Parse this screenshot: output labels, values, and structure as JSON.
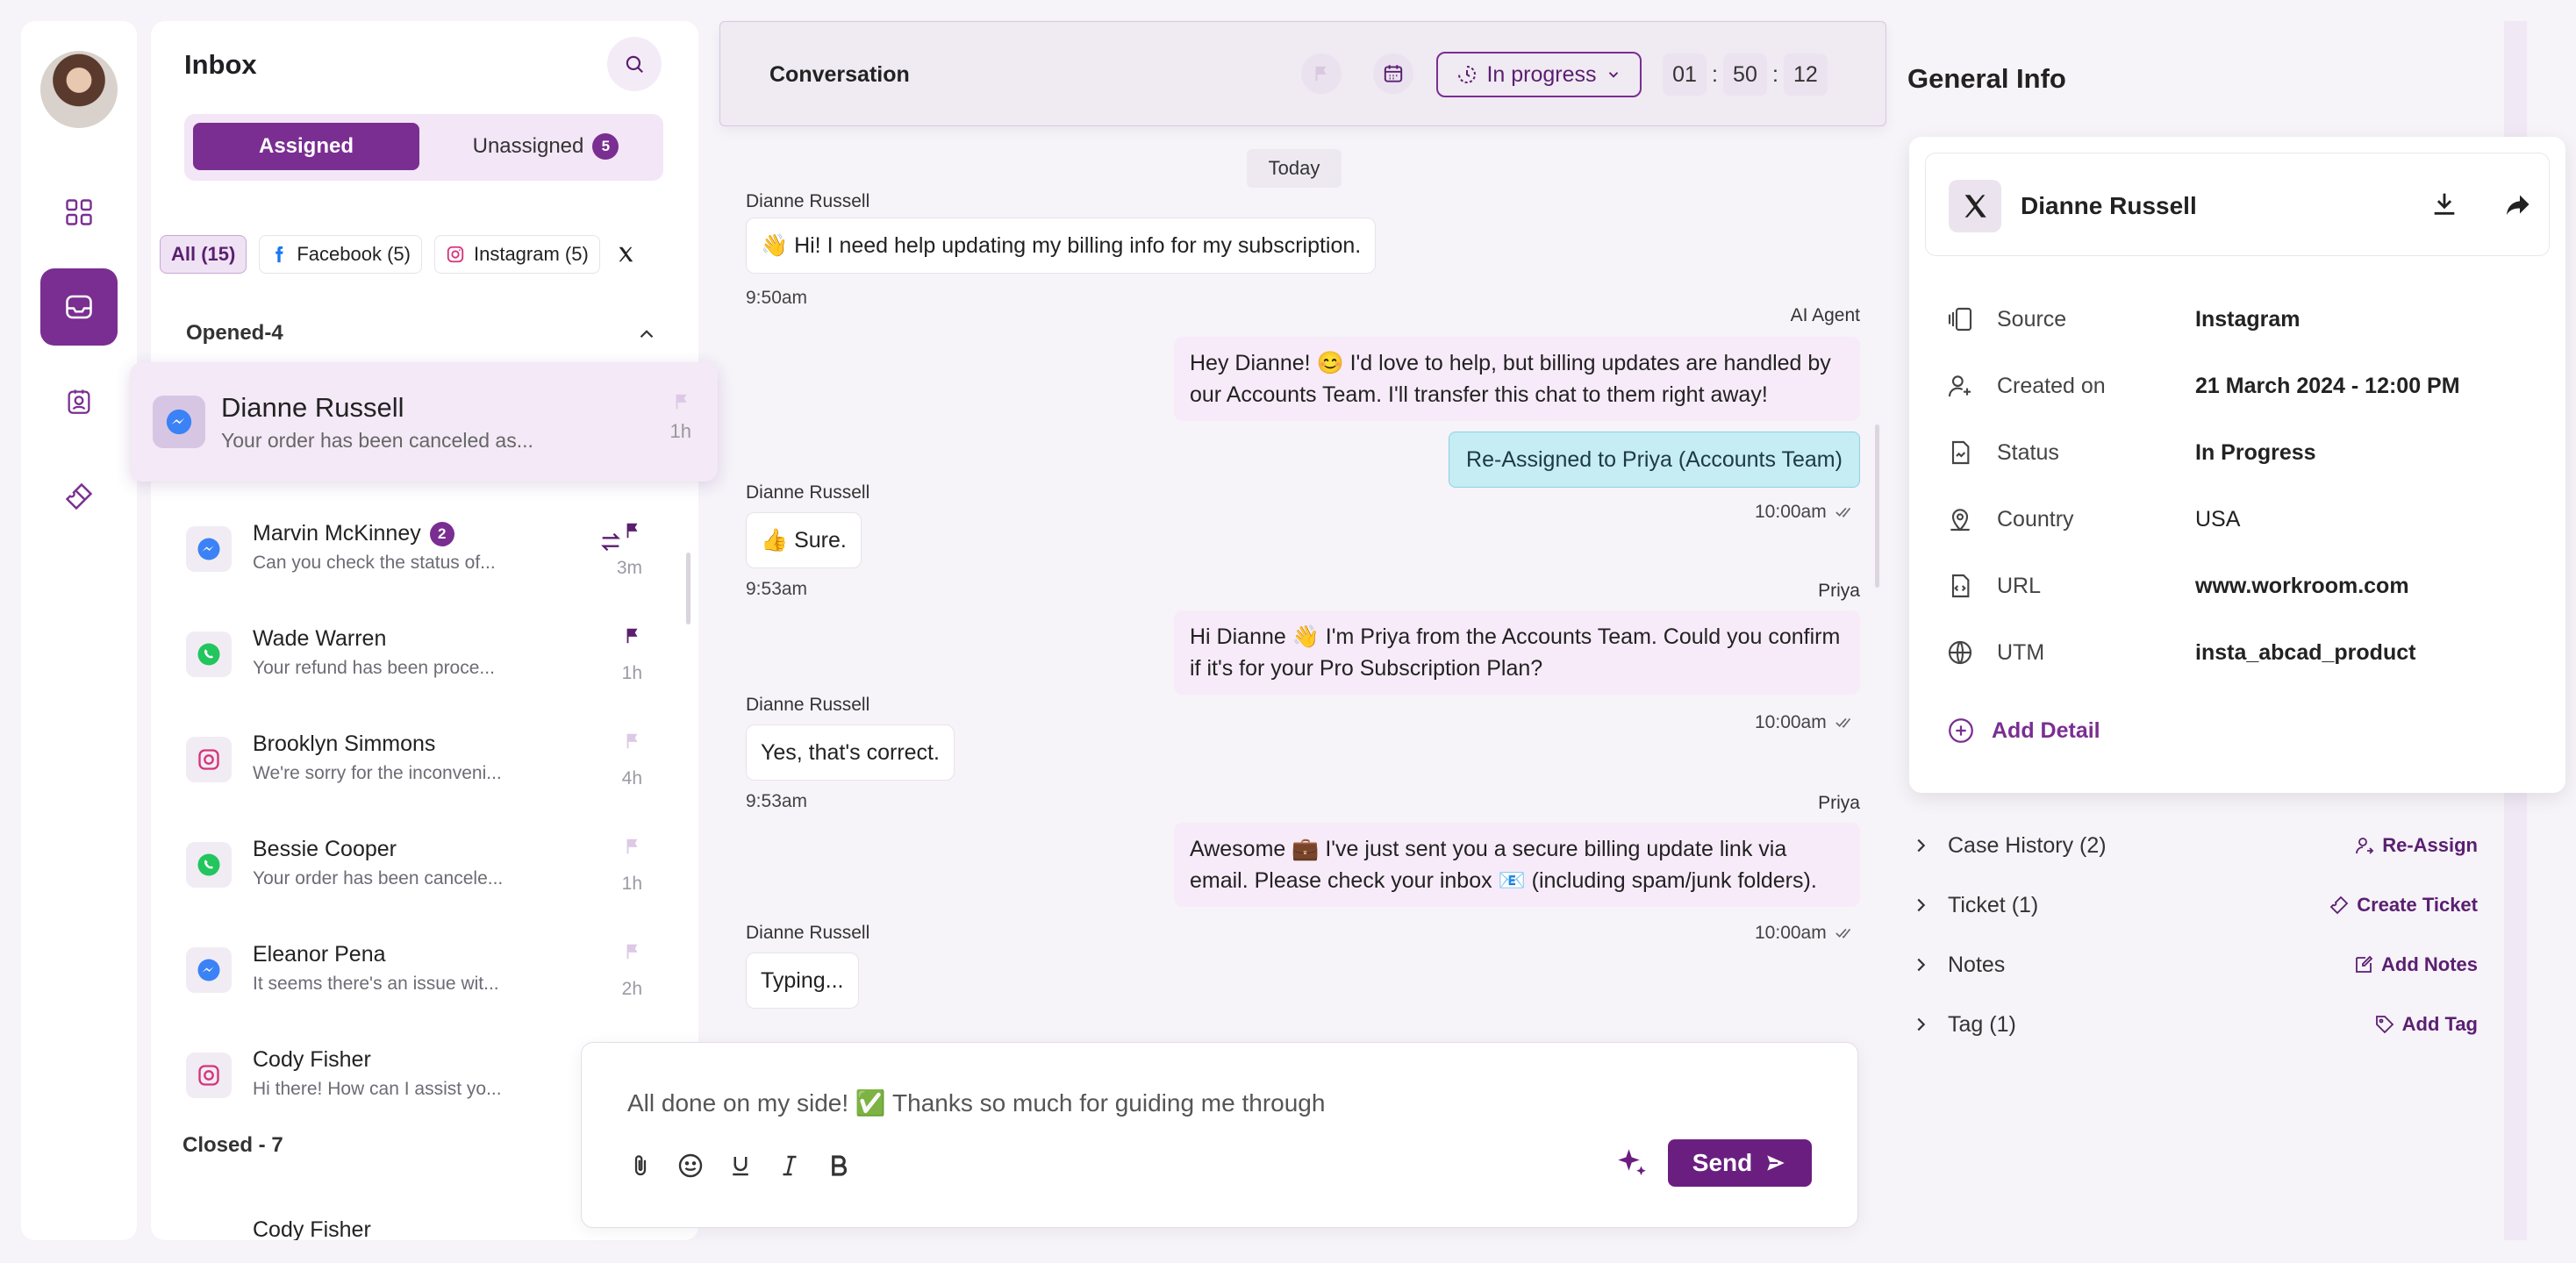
{
  "rail": {
    "items": [
      "dashboard-icon",
      "inbox-icon",
      "contacts-icon",
      "tickets-icon"
    ]
  },
  "inbox": {
    "title": "Inbox",
    "tabs": {
      "assigned": "Assigned",
      "unassigned": "Unassigned",
      "unassigned_count": "5"
    },
    "filters": [
      "All (15)",
      "Facebook (5)",
      "Instagram (5)"
    ],
    "opened_label": "Opened-4",
    "closed_label": "Closed - 7",
    "selected": {
      "name": "Dianne Russell",
      "preview": "Your order has been canceled as...",
      "time": "1h",
      "channel": "messenger"
    },
    "items": [
      {
        "name": "Marvin McKinney",
        "badge": "2",
        "preview": "Can you check the status of...",
        "time": "3m",
        "channel": "messenger",
        "flag": "filled"
      },
      {
        "name": "Wade Warren",
        "badge": "",
        "preview": "Your refund has been proce...",
        "time": "1h",
        "channel": "whatsapp",
        "flag": "filled"
      },
      {
        "name": "Brooklyn Simmons",
        "badge": "",
        "preview": "We're sorry for the inconveni...",
        "time": "4h",
        "channel": "instagram",
        "flag": "light"
      },
      {
        "name": "Bessie Cooper",
        "badge": "",
        "preview": "Your order has been cancele...",
        "time": "1h",
        "channel": "whatsapp",
        "flag": "light"
      },
      {
        "name": "Eleanor Pena",
        "badge": "",
        "preview": "It seems there's an issue wit...",
        "time": "2h",
        "channel": "messenger",
        "flag": "light"
      },
      {
        "name": "Cody Fisher",
        "badge": "",
        "preview": "Hi there! How can I assist yo...",
        "time": "",
        "channel": "instagram",
        "flag": "none"
      }
    ],
    "closed_first": "Cody Fisher"
  },
  "conversation": {
    "title": "Conversation",
    "status": "In progress",
    "timer": {
      "h": "01",
      "m": "50",
      "s": "12"
    },
    "day": "Today",
    "messages": {
      "m1_sender": "Dianne Russell",
      "m1_text": "👋 Hi! I need help updating my billing info for my subscription.",
      "m1_time": "9:50am",
      "m2_sender": "AI Agent",
      "m2_text": "Hey Dianne! 😊 I'd love to help, but billing updates are handled by our Accounts Team. I'll transfer this chat to them right away!",
      "reassigned": "Re-Assigned to Priya (Accounts Team)",
      "m2_time": "10:00am",
      "m3_sender": "Dianne Russell",
      "m3_text": "👍 Sure.",
      "m3_time": "9:53am",
      "m4_sender": "Priya",
      "m4_text": "Hi Dianne 👋 I'm Priya from the Accounts Team. Could you confirm if it's for your Pro Subscription Plan?",
      "m4_time": "10:00am",
      "m5_sender": "Dianne Russell",
      "m5_text": "Yes, that's correct.",
      "m5_time": "9:53am",
      "m6_sender": "Priya",
      "m6_text": "Awesome 💼 I've just sent you a secure billing update link via email. Please check your inbox 📧 (including spam/junk folders).",
      "m6_time": "10:00am",
      "m7_sender": "Dianne Russell",
      "m7_text": "Typing..."
    },
    "composer": {
      "text": "All done on my side! ✅ Thanks so much for guiding me through",
      "send": "Send"
    }
  },
  "general": {
    "title": "General Info",
    "contact_name": "Dianne Russell",
    "rows": [
      {
        "label": "Source",
        "value": "Instagram"
      },
      {
        "label": "Created on",
        "value": "21 March 2024 - 12:00 PM"
      },
      {
        "label": "Status",
        "value": "In Progress"
      },
      {
        "label": "Country",
        "value": "USA"
      },
      {
        "label": "URL",
        "value": "www.workroom.com"
      },
      {
        "label": "UTM",
        "value": "insta_abcad_product"
      }
    ],
    "add_detail": "Add Detail",
    "sections": [
      {
        "label": "Case History (2)",
        "action": "Re-Assign"
      },
      {
        "label": "Ticket (1)",
        "action": "Create Ticket"
      },
      {
        "label": "Notes",
        "action": "Add Notes"
      },
      {
        "label": "Tag (1)",
        "action": "Add Tag"
      }
    ]
  },
  "colors": {
    "accent": "#7a2e91",
    "accent_dark": "#6a1f80",
    "reassigned_bg": "#c6ecf4",
    "outgoing_bg": "#f7ebf9"
  }
}
